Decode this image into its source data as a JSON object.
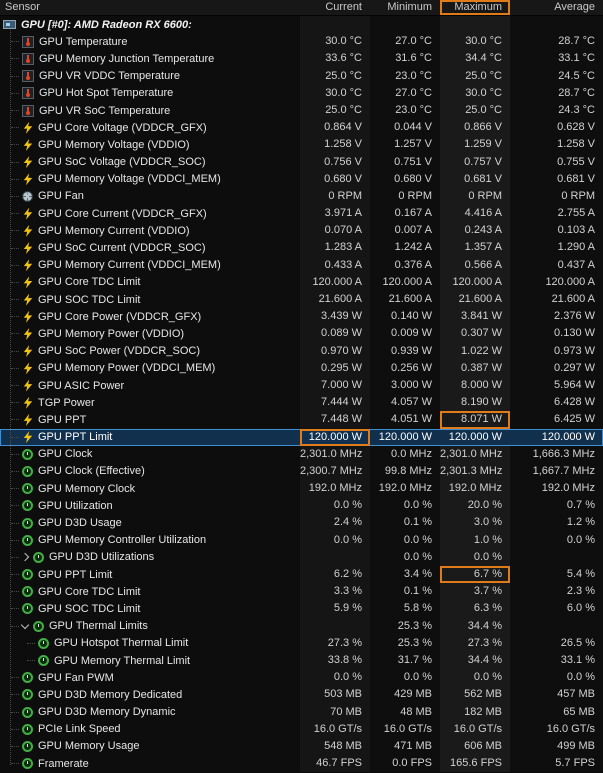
{
  "header": {
    "sensor": "Sensor",
    "columns": [
      "Current",
      "Minimum",
      "Maximum",
      "Average"
    ],
    "highlighted_column": "Maximum"
  },
  "group": {
    "label": "GPU [#0]: AMD Radeon RX 6600:"
  },
  "accent_colors": {
    "highlight_box": "#e07b1a",
    "selection": "#3f8fd2",
    "gauge_green": "#43ae43",
    "bolt_yellow": "#f2c40f"
  },
  "rows": [
    {
      "label": "GPU Temperature",
      "icon": "temperature",
      "values": [
        "30.0 °C",
        "27.0 °C",
        "30.0 °C",
        "28.7 °C"
      ]
    },
    {
      "label": "GPU Memory Junction Temperature",
      "icon": "temperature",
      "values": [
        "33.6 °C",
        "31.6 °C",
        "34.4 °C",
        "33.1 °C"
      ]
    },
    {
      "label": "GPU VR VDDC Temperature",
      "icon": "temperature",
      "values": [
        "25.0 °C",
        "23.0 °C",
        "25.0 °C",
        "24.5 °C"
      ]
    },
    {
      "label": "GPU Hot Spot Temperature",
      "icon": "temperature",
      "values": [
        "30.0 °C",
        "27.0 °C",
        "30.0 °C",
        "28.7 °C"
      ]
    },
    {
      "label": "GPU VR SoC Temperature",
      "icon": "temperature",
      "values": [
        "25.0 °C",
        "23.0 °C",
        "25.0 °C",
        "24.3 °C"
      ]
    },
    {
      "label": "GPU Core Voltage (VDDCR_GFX)",
      "icon": "bolt",
      "values": [
        "0.864 V",
        "0.044 V",
        "0.866 V",
        "0.628 V"
      ]
    },
    {
      "label": "GPU Memory Voltage (VDDIO)",
      "icon": "bolt",
      "values": [
        "1.258 V",
        "1.257 V",
        "1.259 V",
        "1.258 V"
      ]
    },
    {
      "label": "GPU SoC Voltage (VDDCR_SOC)",
      "icon": "bolt",
      "values": [
        "0.756 V",
        "0.751 V",
        "0.757 V",
        "0.755 V"
      ]
    },
    {
      "label": "GPU Memory Voltage (VDDCI_MEM)",
      "icon": "bolt",
      "values": [
        "0.680 V",
        "0.680 V",
        "0.681 V",
        "0.681 V"
      ]
    },
    {
      "label": "GPU Fan",
      "icon": "fan",
      "values": [
        "0 RPM",
        "0 RPM",
        "0 RPM",
        "0 RPM"
      ]
    },
    {
      "label": "GPU Core Current (VDDCR_GFX)",
      "icon": "bolt",
      "values": [
        "3.971 A",
        "0.167 A",
        "4.416 A",
        "2.755 A"
      ]
    },
    {
      "label": "GPU Memory Current (VDDIO)",
      "icon": "bolt",
      "values": [
        "0.070 A",
        "0.007 A",
        "0.243 A",
        "0.103 A"
      ]
    },
    {
      "label": "GPU SoC Current (VDDCR_SOC)",
      "icon": "bolt",
      "values": [
        "1.283 A",
        "1.242 A",
        "1.357 A",
        "1.290 A"
      ]
    },
    {
      "label": "GPU Memory Current (VDDCI_MEM)",
      "icon": "bolt",
      "values": [
        "0.433 A",
        "0.376 A",
        "0.566 A",
        "0.437 A"
      ]
    },
    {
      "label": "GPU Core TDC Limit",
      "icon": "bolt",
      "values": [
        "120.000 A",
        "120.000 A",
        "120.000 A",
        "120.000 A"
      ]
    },
    {
      "label": "GPU SOC TDC Limit",
      "icon": "bolt",
      "values": [
        "21.600 A",
        "21.600 A",
        "21.600 A",
        "21.600 A"
      ]
    },
    {
      "label": "GPU Core Power (VDDCR_GFX)",
      "icon": "bolt",
      "values": [
        "3.439 W",
        "0.140 W",
        "3.841 W",
        "2.376 W"
      ]
    },
    {
      "label": "GPU Memory Power (VDDIO)",
      "icon": "bolt",
      "values": [
        "0.089 W",
        "0.009 W",
        "0.307 W",
        "0.130 W"
      ]
    },
    {
      "label": "GPU SoC Power (VDDCR_SOC)",
      "icon": "bolt",
      "values": [
        "0.970 W",
        "0.939 W",
        "1.022 W",
        "0.973 W"
      ]
    },
    {
      "label": "GPU Memory Power (VDDCI_MEM)",
      "icon": "bolt",
      "values": [
        "0.295 W",
        "0.256 W",
        "0.387 W",
        "0.297 W"
      ]
    },
    {
      "label": "GPU ASIC Power",
      "icon": "bolt",
      "values": [
        "7.000 W",
        "3.000 W",
        "8.000 W",
        "5.964 W"
      ]
    },
    {
      "label": "TGP Power",
      "icon": "bolt",
      "values": [
        "7.444 W",
        "4.057 W",
        "8.190 W",
        "6.428 W"
      ]
    },
    {
      "label": "GPU PPT",
      "icon": "bolt",
      "values": [
        "7.448 W",
        "4.051 W",
        "8.071 W",
        "6.425 W"
      ],
      "hl": 2
    },
    {
      "label": "GPU PPT Limit",
      "icon": "bolt",
      "values": [
        "120.000 W",
        "120.000 W",
        "120.000 W",
        "120.000 W"
      ],
      "selected": true,
      "hl": 0
    },
    {
      "label": "GPU Clock",
      "icon": "gauge",
      "values": [
        "2,301.0 MHz",
        "0.0 MHz",
        "2,301.0 MHz",
        "1,666.3 MHz"
      ]
    },
    {
      "label": "GPU Clock (Effective)",
      "icon": "gauge",
      "values": [
        "2,300.7 MHz",
        "99.8 MHz",
        "2,301.3 MHz",
        "1,667.7 MHz"
      ]
    },
    {
      "label": "GPU Memory Clock",
      "icon": "gauge",
      "values": [
        "192.0 MHz",
        "192.0 MHz",
        "192.0 MHz",
        "192.0 MHz"
      ]
    },
    {
      "label": "GPU Utilization",
      "icon": "gauge",
      "values": [
        "0.0 %",
        "0.0 %",
        "20.0 %",
        "0.7 %"
      ]
    },
    {
      "label": "GPU D3D Usage",
      "icon": "gauge",
      "values": [
        "2.4 %",
        "0.1 %",
        "3.0 %",
        "1.2 %"
      ]
    },
    {
      "label": "GPU Memory Controller Utilization",
      "icon": "gauge",
      "values": [
        "0.0 %",
        "0.0 %",
        "1.0 %",
        "0.0 %"
      ]
    },
    {
      "label": "GPU D3D Utilizations",
      "icon": "gauge",
      "arrow": "right",
      "values": [
        "",
        "0.0 %",
        "0.0 %",
        ""
      ]
    },
    {
      "label": "GPU PPT Limit",
      "icon": "gauge",
      "values": [
        "6.2 %",
        "3.4 %",
        "6.7 %",
        "5.4 %"
      ],
      "hl": 2
    },
    {
      "label": "GPU Core TDC Limit",
      "icon": "gauge",
      "values": [
        "3.3 %",
        "0.1 %",
        "3.7 %",
        "2.3 %"
      ]
    },
    {
      "label": "GPU SOC TDC Limit",
      "icon": "gauge",
      "values": [
        "5.9 %",
        "5.8 %",
        "6.3 %",
        "6.0 %"
      ]
    },
    {
      "label": "GPU Thermal Limits",
      "icon": "gauge",
      "arrow": "down",
      "values": [
        "",
        "25.3 %",
        "34.4 %",
        ""
      ]
    },
    {
      "label": "GPU Hotspot Thermal Limit",
      "icon": "gauge",
      "level": 1,
      "values": [
        "27.3 %",
        "25.3 %",
        "27.3 %",
        "26.5 %"
      ]
    },
    {
      "label": "GPU Memory Thermal Limit",
      "icon": "gauge",
      "level": 1,
      "values": [
        "33.8 %",
        "31.7 %",
        "34.4 %",
        "33.1 %"
      ]
    },
    {
      "label": "GPU Fan PWM",
      "icon": "gauge",
      "values": [
        "0.0 %",
        "0.0 %",
        "0.0 %",
        "0.0 %"
      ]
    },
    {
      "label": "GPU D3D Memory Dedicated",
      "icon": "gauge",
      "values": [
        "503 MB",
        "429 MB",
        "562 MB",
        "457 MB"
      ]
    },
    {
      "label": "GPU D3D Memory Dynamic",
      "icon": "gauge",
      "values": [
        "70 MB",
        "48 MB",
        "182 MB",
        "65 MB"
      ]
    },
    {
      "label": "PCIe Link Speed",
      "icon": "gauge",
      "values": [
        "16.0 GT/s",
        "16.0 GT/s",
        "16.0 GT/s",
        "16.0 GT/s"
      ]
    },
    {
      "label": "GPU Memory Usage",
      "icon": "gauge",
      "values": [
        "548 MB",
        "471 MB",
        "606 MB",
        "499 MB"
      ]
    },
    {
      "label": "Framerate",
      "icon": "gauge",
      "values": [
        "46.7 FPS",
        "0.0 FPS",
        "165.6 FPS",
        "5.7 FPS"
      ]
    }
  ]
}
